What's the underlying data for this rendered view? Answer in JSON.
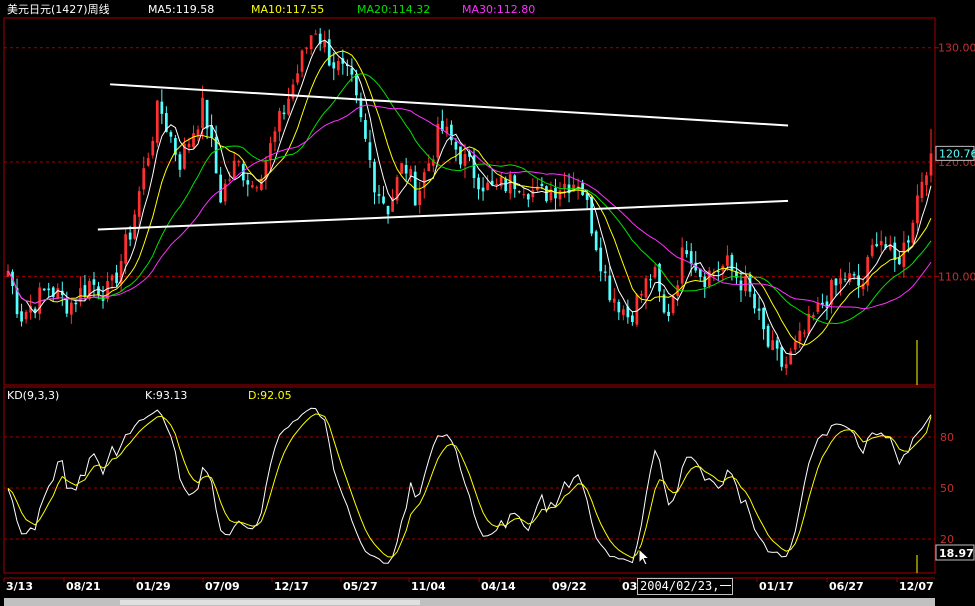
{
  "header": {
    "title": "美元日元(1427)周线",
    "ma5": "MA5:119.58",
    "ma10": "MA10:117.55",
    "ma20": "MA20:114.32",
    "ma30": "MA30:112.80"
  },
  "kd_header": {
    "name": "KD(9,3,3)",
    "k": "K:93.13",
    "d": "D:92.05"
  },
  "date_box": "2004/02/23,一",
  "colors": {
    "up": "#ff3030",
    "down": "#54ffff",
    "ma5": "#ffffff",
    "ma10": "#ffff00",
    "ma20": "#00e000",
    "ma30": "#ff30ff",
    "grid": "#a00000",
    "frame": "#a00000",
    "title": "#ffffff",
    "trendline": "#ffffff"
  },
  "chart_data": [
    {
      "type": "candlestick",
      "title": "美元日元(1427)周线",
      "price_labels": [
        "130.00",
        "120.00",
        "110.00"
      ],
      "price_ticks": [
        130,
        120,
        110
      ],
      "ylim": [
        100.5,
        132.6
      ],
      "current_price_label": "120.76",
      "current_price": 120.76,
      "x_tick_labels": [
        "3/13",
        "08/21",
        "01/29",
        "07/09",
        "12/17",
        "05/27",
        "11/04",
        "04/14",
        "09/22",
        "03",
        "01/17",
        "06/27",
        "12/07"
      ],
      "num_bars": 205,
      "close_anchors": [
        [
          0,
          110.5
        ],
        [
          3,
          106.5
        ],
        [
          10,
          109
        ],
        [
          15,
          107.5
        ],
        [
          20,
          109.5
        ],
        [
          25,
          108.5
        ],
        [
          30,
          114
        ],
        [
          37,
          125
        ],
        [
          42,
          120
        ],
        [
          48,
          125
        ],
        [
          52,
          117
        ],
        [
          56,
          120
        ],
        [
          60,
          118
        ],
        [
          64,
          121
        ],
        [
          70,
          127
        ],
        [
          75,
          132
        ],
        [
          79,
          129
        ],
        [
          84,
          127
        ],
        [
          90,
          118
        ],
        [
          93,
          116
        ],
        [
          97,
          120
        ],
        [
          100,
          117
        ],
        [
          106,
          123
        ],
        [
          112,
          120
        ],
        [
          118,
          117.5
        ],
        [
          125,
          118.5
        ],
        [
          130,
          117
        ],
        [
          135,
          118
        ],
        [
          140,
          118.5
        ],
        [
          147,
          109
        ],
        [
          152,
          106.5
        ],
        [
          158,
          110.5
        ],
        [
          161,
          106
        ],
        [
          166,
          113
        ],
        [
          170,
          110
        ],
        [
          176,
          111
        ],
        [
          181,
          109
        ],
        [
          186,
          104
        ],
        [
          190,
          102
        ],
        [
          195,
          105
        ],
        [
          200,
          108
        ],
        [
          205,
          110
        ],
        [
          209,
          109
        ],
        [
          213,
          114
        ],
        [
          217,
          111
        ],
        [
          220,
          113
        ],
        [
          224,
          119
        ],
        [
          226,
          121
        ]
      ],
      "trendlines": [
        {
          "from": [
            25,
            126.8
          ],
          "to": [
            191,
            123.2
          ]
        },
        {
          "from": [
            22,
            114.1
          ],
          "to": [
            191,
            116.6
          ]
        }
      ],
      "moving_averages": [
        {
          "name": "MA5",
          "period": 5
        },
        {
          "name": "MA10",
          "period": 10
        },
        {
          "name": "MA20",
          "period": 20
        },
        {
          "name": "MA30",
          "period": 30
        }
      ]
    },
    {
      "type": "line",
      "title": "KD(9,3,3)",
      "y_tick_labels": [
        "80",
        "50",
        "20"
      ],
      "y_ticks": [
        80,
        50,
        20
      ],
      "ylim": [
        0,
        100
      ],
      "current_value_label": "18.97",
      "current_value": 18.97,
      "series": [
        {
          "name": "K",
          "last": 93.13
        },
        {
          "name": "D",
          "last": 92.05
        }
      ]
    }
  ]
}
